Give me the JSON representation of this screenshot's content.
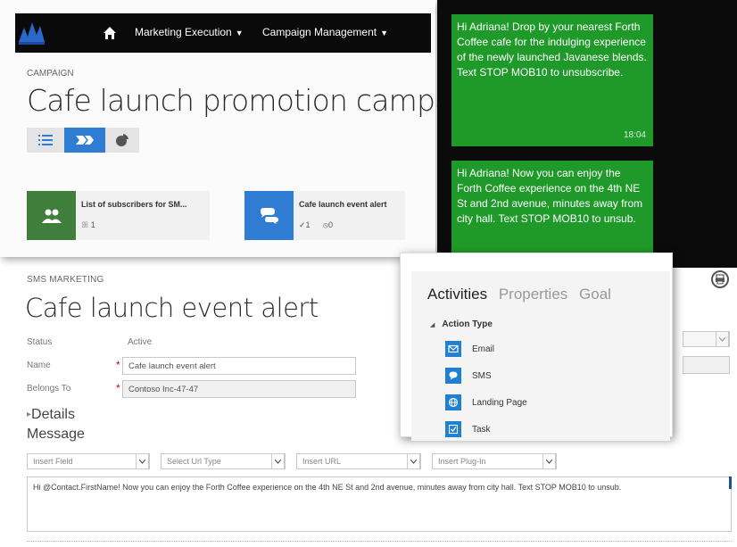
{
  "colors": {
    "nav_bg": "#0a0a0a",
    "accent_blue": "#2e7dd2",
    "card_green": "#3f7e3b",
    "sms_green": "#1f9a2a",
    "sms_bg": "#0b0b0b",
    "required_star": "#dd0000"
  },
  "nav": {
    "logo_icon": "dynamics-logo-icon",
    "home_icon": "home-icon",
    "items": [
      {
        "label": "Marketing Execution"
      },
      {
        "label": "Campaign Management"
      }
    ]
  },
  "campaign": {
    "entity_label": "CAMPAIGN",
    "title": "Cafe launch promotion campaign",
    "view_buttons": [
      {
        "icon": "list-view-icon"
      },
      {
        "icon": "flow-view-icon",
        "selected": true
      },
      {
        "icon": "pie-chart-icon"
      }
    ],
    "cards": [
      {
        "icon": "people-icon",
        "title": "List of subscribers for SM...",
        "count": "1"
      },
      {
        "icon": "chat-bubble-icon",
        "title": "Cafe launch event alert",
        "check_count": "1",
        "block_count": "0"
      }
    ]
  },
  "sms": {
    "messages": [
      {
        "text": "Hi Adriana! Drop by your nearest Forth Coffee cafe for the indulging experience of the newly launched Javanese blends. Text STOP MOB10 to unsubscribe.",
        "time": "18:04"
      },
      {
        "text": "Hi Adriana! Now you can enjoy the Forth Coffee experience on the 4th NE St and 2nd avenue, minutes away from city hall. Text STOP MOB10 to unsub.",
        "time": ""
      }
    ]
  },
  "form": {
    "entity_label": "SMS MARKETING",
    "title": "Cafe launch event alert",
    "fields": {
      "status_label": "Status",
      "status_value": "Active",
      "name_label": "Name",
      "name_value": "Cafe launch event alert",
      "belongs_label": "Belongs To",
      "belongs_value": "Contoso Inc-47-47",
      "required_mark": "*"
    },
    "details_label": "Details",
    "message_label": "Message",
    "selects": [
      {
        "value": "Insert Field"
      },
      {
        "value": "Select Url Type"
      },
      {
        "value": "Insert URL"
      },
      {
        "value": "Insert Plug-In"
      }
    ],
    "message_text": "Hi @Contact.FirstName! Now you can enjoy the Forth Coffee experience on the 4th NE St and 2nd avenue, minutes away from city hall. Text STOP MOB10 to unsub."
  },
  "activities": {
    "tabs": [
      {
        "label": "Activities",
        "active": true
      },
      {
        "label": "Properties",
        "active": false
      },
      {
        "label": "Goal",
        "active": false
      }
    ],
    "group_label": "Action Type",
    "items": [
      {
        "label": "Email",
        "icon": "email-icon"
      },
      {
        "label": "SMS",
        "icon": "sms-icon"
      },
      {
        "label": "Landing Page",
        "icon": "globe-icon"
      },
      {
        "label": "Task",
        "icon": "task-icon"
      }
    ]
  }
}
